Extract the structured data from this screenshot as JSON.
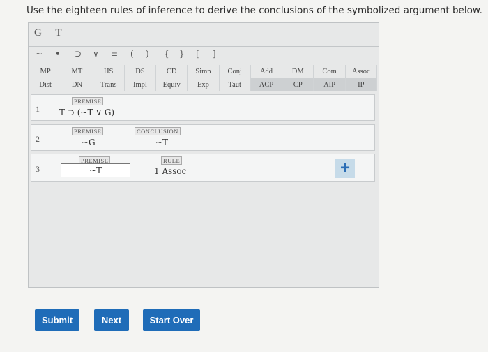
{
  "instruction": "Use the eighteen rules of inference to derive the conclusions of the symbolized argument below.",
  "variables": [
    "G",
    "T"
  ],
  "symbols": [
    "~",
    "•",
    "⊃",
    "∨",
    "≡",
    "(",
    ")",
    "{",
    "}",
    "[",
    "]"
  ],
  "rules_row1": [
    "MP",
    "MT",
    "HS",
    "DS",
    "CD",
    "Simp",
    "Conj",
    "Add",
    "DM",
    "Com",
    "Assoc"
  ],
  "rules_row2": [
    "Dist",
    "DN",
    "Trans",
    "Impl",
    "Equiv",
    "Exp",
    "Taut",
    "ACP",
    "CP",
    "AIP",
    "IP"
  ],
  "lines": [
    {
      "num": "1",
      "tag": "PREMISE",
      "formula": "T ⊃ (~T ∨ G)"
    },
    {
      "num": "2",
      "tag": "PREMISE",
      "formula": "~G",
      "conclusion_tag": "CONCLUSION",
      "conclusion": "~T"
    },
    {
      "num": "3",
      "tag": "PREMISE",
      "formula": "~T",
      "rule_tag": "RULE",
      "rule": "1 Assoc"
    }
  ],
  "buttons": {
    "submit": "Submit",
    "next": "Next",
    "start_over": "Start Over"
  },
  "colors": {
    "button": "#1f6cb8",
    "plus": "#2a6db5"
  }
}
